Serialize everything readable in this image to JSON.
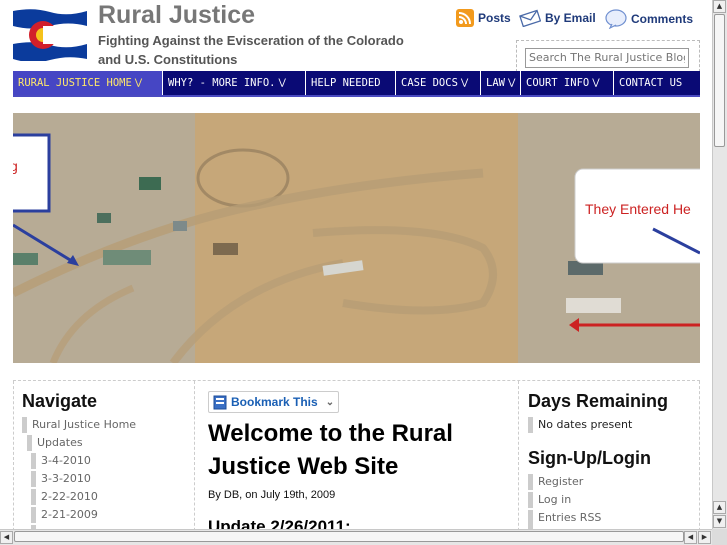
{
  "header": {
    "site_title": "Rural Justice",
    "tagline": "Fighting Against the Evisceration of the Colorado and U.S. Constitutions",
    "logo_icon": "colorado-flag-icon"
  },
  "subscribe": {
    "posts_label": "Posts",
    "email_label": "By Email",
    "comments_label": "Comments"
  },
  "search": {
    "placeholder": "Search The Rural Justice Blog"
  },
  "nav": {
    "items": [
      {
        "label": "RURAL JUSTICE HOME"
      },
      {
        "label": "WHY? - MORE INFO."
      },
      {
        "label": "HELP NEEDED"
      },
      {
        "label": "CASE DOCS"
      },
      {
        "label": "LAW"
      },
      {
        "label": "COURT INFO"
      },
      {
        "label": "CONTACT US"
      }
    ]
  },
  "banner": {
    "callout_left": "g",
    "callout_right": "They Entered He"
  },
  "sidebar_left": {
    "heading": "Navigate",
    "links": [
      "Rural Justice Home",
      "Updates",
      "3-4-2010",
      "3-3-2010",
      "2-22-2010",
      "2-21-2009"
    ]
  },
  "main": {
    "bookmark_label": "Bookmark This",
    "post_title": "Welcome to the Rural Justice Web Site",
    "byline": "By DB, on July 19th, 2009",
    "update_heading": "Update 2/26/2011:"
  },
  "sidebar_right": {
    "days_heading": "Days Remaining",
    "days_text": "No dates present",
    "signup_heading": "Sign-Up/Login",
    "links": [
      "Register",
      "Log in",
      "Entries RSS"
    ]
  },
  "colors": {
    "nav_bg": "#0a0a75",
    "nav_active_bg": "#4646c4",
    "nav_active_text": "#ffe86a",
    "link_blue": "#1a5fb4",
    "callout_red": "#cc2222"
  }
}
